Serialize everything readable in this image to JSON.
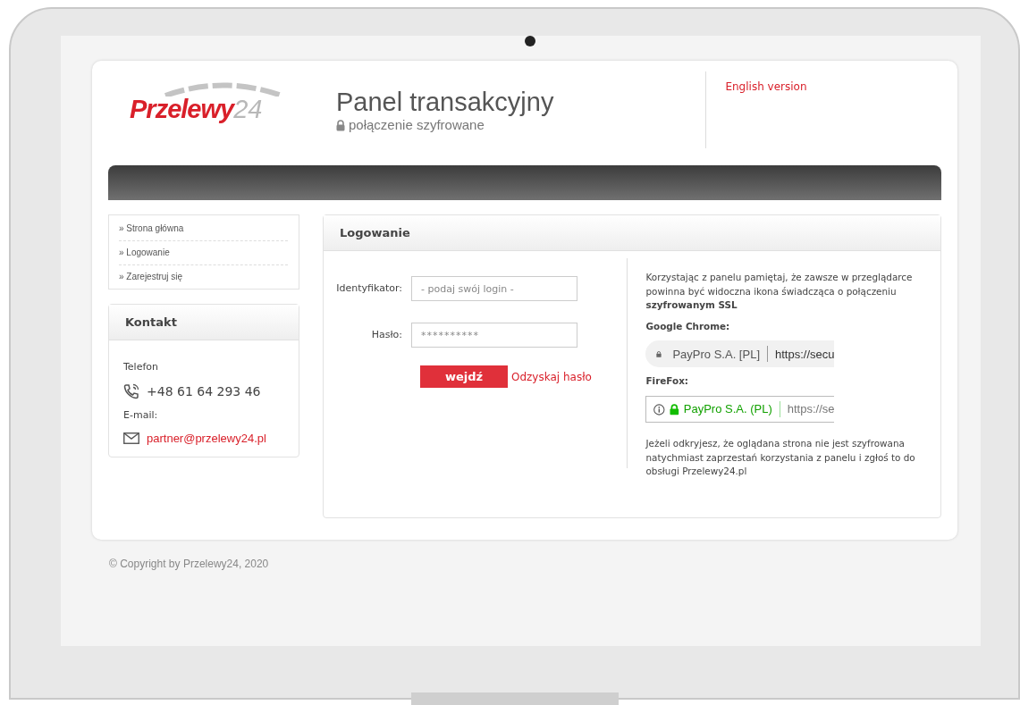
{
  "header": {
    "logo": {
      "brand": "Przelewy",
      "number": "24"
    },
    "title": "Panel transakcyjny",
    "subtitle": "połączenie szyfrowane",
    "language_link": "English version"
  },
  "menu": [
    {
      "label": "» Strona główna"
    },
    {
      "label": "» Logowanie"
    },
    {
      "label": "» Zarejestruj się"
    }
  ],
  "contact": {
    "title": "Kontakt",
    "phone_label": "Telefon",
    "phone": "+48 61 64 293 46",
    "email_label": "E-mail:",
    "email": "partner@przelewy24.pl"
  },
  "login": {
    "title": "Logowanie",
    "fields": [
      {
        "kind": "text",
        "label": "Identyfikator:",
        "placeholder": "- podaj swój login -"
      },
      {
        "kind": "password",
        "label": "Hasło:",
        "placeholder": "**********"
      }
    ],
    "submit": "wejdź",
    "recover_link": "Odzyskaj hasło"
  },
  "info": {
    "intro": "Korzystając z panelu pamiętaj, że zawsze w przeglądarce powinna być widoczna ikona świadcząca o połączeniu **szyfrowanym SSL**",
    "browsers": [
      {
        "kind": "chrome",
        "label": "Google Chrome:",
        "site": "PayPro S.A. [PL]",
        "url": "https://secu"
      },
      {
        "kind": "firefox",
        "label": "FireFox:",
        "site": "PayPro S.A. (PL)",
        "url": "https://se"
      }
    ],
    "warning": "Jeżeli odkryjesz, że oglądana strona nie jest szyfrowana natychmiast zaprzestań korzystania z panelu i zgłoś to do obsługi Przelewy24.pl"
  },
  "footer": "© Copyright by Przelewy24, 2020"
}
